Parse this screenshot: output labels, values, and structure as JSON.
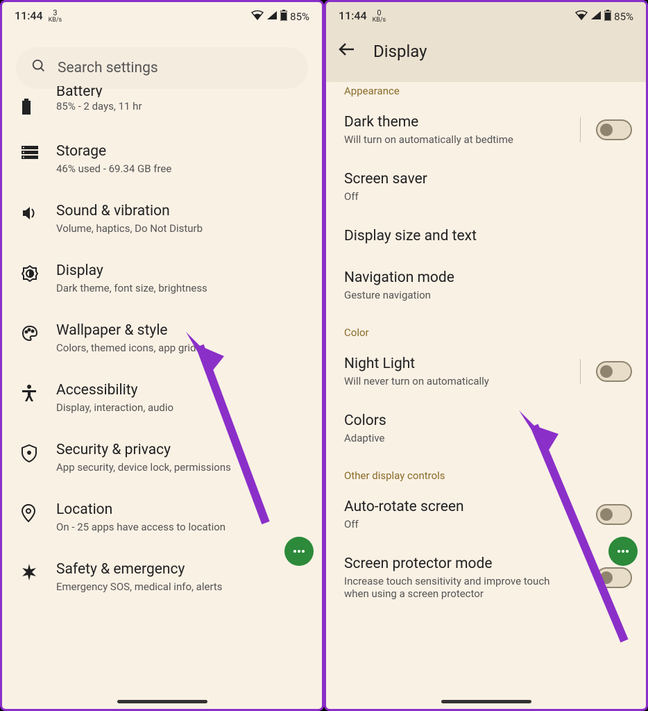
{
  "left": {
    "statusbar": {
      "time": "11:44",
      "speed_num": "3",
      "speed_unit": "KB/s",
      "battery": "85%"
    },
    "search_placeholder": "Search settings",
    "items": [
      {
        "title": "Battery",
        "sub": "85% - 2 days, 11 hr"
      },
      {
        "title": "Storage",
        "sub": "46% used - 69.34 GB free"
      },
      {
        "title": "Sound & vibration",
        "sub": "Volume, haptics, Do Not Disturb"
      },
      {
        "title": "Display",
        "sub": "Dark theme, font size, brightness"
      },
      {
        "title": "Wallpaper & style",
        "sub": "Colors, themed icons, app grid"
      },
      {
        "title": "Accessibility",
        "sub": "Display, interaction, audio"
      },
      {
        "title": "Security & privacy",
        "sub": "App security, device lock, permissions"
      },
      {
        "title": "Location",
        "sub": "On - 25 apps have access to location"
      },
      {
        "title": "Safety & emergency",
        "sub": "Emergency SOS, medical info, alerts"
      }
    ]
  },
  "right": {
    "statusbar": {
      "time": "11:44",
      "speed_num": "0",
      "speed_unit": "KB/s",
      "battery": "85%"
    },
    "header": "Display",
    "section_appearance": "Appearance",
    "section_color": "Color",
    "section_other": "Other display controls",
    "items": {
      "dark_theme": {
        "title": "Dark theme",
        "sub": "Will turn on automatically at bedtime"
      },
      "screen_saver": {
        "title": "Screen saver",
        "sub": "Off"
      },
      "display_size": {
        "title": "Display size and text"
      },
      "nav_mode": {
        "title": "Navigation mode",
        "sub": "Gesture navigation"
      },
      "night_light": {
        "title": "Night Light",
        "sub": "Will never turn on automatically"
      },
      "colors": {
        "title": "Colors",
        "sub": "Adaptive"
      },
      "auto_rotate": {
        "title": "Auto-rotate screen",
        "sub": "Off"
      },
      "protector": {
        "title": "Screen protector mode",
        "sub": "Increase touch sensitivity and improve touch when using a screen protector"
      }
    }
  }
}
